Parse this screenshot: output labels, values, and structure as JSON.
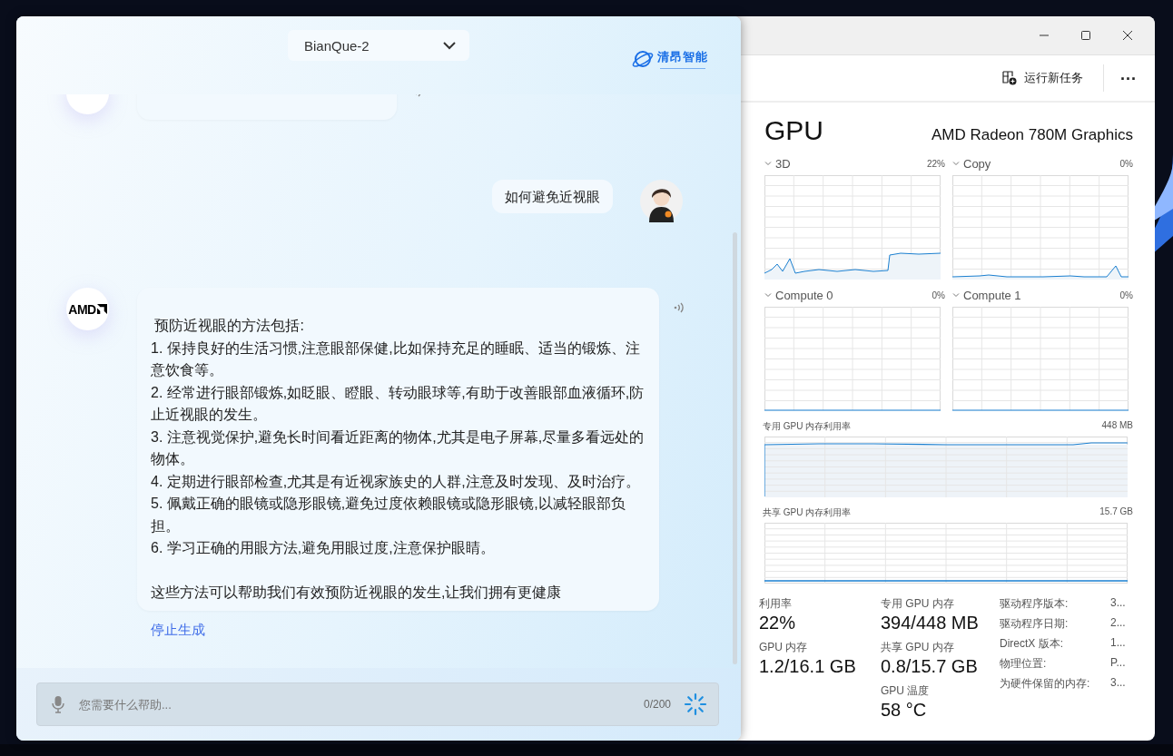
{
  "chat_window": {
    "model_select": {
      "value": "BianQue-2"
    },
    "logo": {
      "name": "清昂智能"
    },
    "messages": [
      {
        "kind": "bot"
      },
      {
        "kind": "user",
        "text": "如何避免近视眼"
      },
      {
        "kind": "bot",
        "avatar": "AMD",
        "paragraphs": [
          " 预防近视眼的方法包括:",
          "1. 保持良好的生活习惯,注意眼部保健,比如保持充足的睡眠、适当的锻炼、注意饮食等。",
          "2. 经常进行眼部锻炼,如眨眼、瞪眼、转动眼球等,有助于改善眼部血液循环,防止近视眼的发生。",
          "3. 注意视觉保护,避免长时间看近距离的物体,尤其是电子屏幕,尽量多看远处的物体。",
          "4. 定期进行眼部检查,尤其是有近视家族史的人群,注意及时发现、及时治疗。",
          "5. 佩戴正确的眼镜或隐形眼镜,避免过度依赖眼镜或隐形眼镜,以减轻眼部负担。",
          "6. 学习正确的用眼方法,避免用眼过度,注意保护眼睛。"
        ],
        "closing": "这些方法可以帮助我们有效预防近视眼的发生,让我们拥有更健康"
      }
    ],
    "stop_link": "停止生成",
    "input": {
      "placeholder": "您需要什么帮助...",
      "counter": "0/200"
    }
  },
  "task_manager": {
    "toolbar": {
      "run_task": "运行新任务",
      "more": "..."
    },
    "title": "GPU",
    "device": "AMD Radeon 780M Graphics",
    "engines": [
      {
        "label": "3D",
        "value": "22%"
      },
      {
        "label": "Copy",
        "value": "0%"
      },
      {
        "label": "Compute 0",
        "value": "0%"
      },
      {
        "label": "Compute 1",
        "value": "0%"
      }
    ],
    "memory_graphs": [
      {
        "label": "专用 GPU 内存利用率",
        "value": "448 MB"
      },
      {
        "label": "共享 GPU 内存利用率",
        "value": "15.7 GB"
      }
    ],
    "stats": [
      {
        "label": "利用率",
        "value": "22%"
      },
      {
        "label": "专用 GPU 内存",
        "value": "394/448 MB"
      },
      {
        "label": "GPU 内存",
        "value": "1.2/16.1 GB"
      },
      {
        "label": "共享 GPU 内存",
        "value": "0.8/15.7 GB"
      },
      {
        "label": "GPU 温度",
        "value": "58 °C"
      }
    ],
    "details": [
      {
        "label": "驱动程序版本:",
        "value": "3..."
      },
      {
        "label": "驱动程序日期:",
        "value": "2..."
      },
      {
        "label": "DirectX 版本:",
        "value": "1..."
      },
      {
        "label": "物理位置:",
        "value": "P..."
      },
      {
        "label": "为硬件保留的内存:",
        "value": "3..."
      }
    ]
  }
}
